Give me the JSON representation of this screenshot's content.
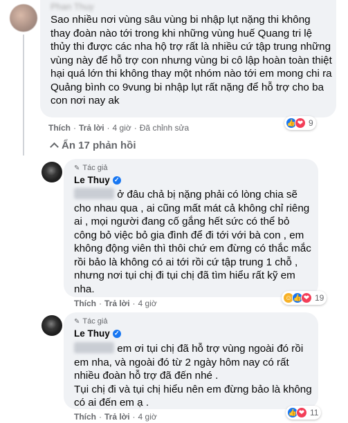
{
  "top_comment": {
    "text": "Sao nhiều nơi vùng sâu vùng bi nhập lụt nặng thi không thay đoàn nào tới trong khi những vùng huế Quang tri lệ thủy thi được các nha hộ trợ rất là nhiều cứ tập trung những vùng này để hỗ trợ con nhưng vùng bi cô lập hoàn toàn thiệt hại quá lớn thi không thay một nhóm nào tới em mong chi ra Quảng bình co 9vung bi nhập lụt rất nặng để hỗ trợ cho ba con nơi nay ak",
    "actions": {
      "like": "Thích",
      "reply": "Trả lời",
      "time": "4 giờ",
      "edited": "Đã chỉnh sửa"
    },
    "reactions": {
      "count": "9",
      "icons": [
        "like-icon",
        "love-icon"
      ]
    }
  },
  "show_replies_label": "Ẩn 17 phản hồi",
  "replies": [
    {
      "author_badge": "Tác giả",
      "author_name": "Le Thuy",
      "text": " ở đâu chả bị nặng phải có lòng chia sẽ cho nhau qua , ai cũng mất mát cả không chỉ riêng ai , mọi người đang cố gắng hết sức có thể bỏ công bỏ việc bỏ gia đình để đi tới với bà con , em không động viên thì thôi chứ em đừng có thắc mắc rồi bảo là không có ai tới rồi cứ tập trung 1 chỗ , nhưng nơi tụi chị đi tụi chị đã tìm hiểu rất kỹ em nha.",
      "actions": {
        "like": "Thích",
        "reply": "Trả lời",
        "time": "4 giờ"
      },
      "reactions": {
        "count": "19",
        "icons": [
          "care-icon",
          "like-icon",
          "love-icon"
        ]
      }
    },
    {
      "author_badge": "Tác giả",
      "author_name": "Le Thuy",
      "text": " em ơi tụi chị đã hỗ trợ vùng ngoài đó rồi em nha, và ngoài đó từ 2 ngày hôm nay có rất nhiều đoàn hỗ trợ đã đến nhé .\nTụi chị đi và tụi chị hiểu nên em đừng bảo là không có ai đến em ạ .",
      "actions": {
        "like": "Thích",
        "reply": "Trả lời",
        "time": "4 giờ"
      },
      "reactions": {
        "count": "11",
        "icons": [
          "like-icon",
          "love-icon"
        ]
      }
    }
  ],
  "colors": {
    "bubble": "#f0f2f5",
    "secondary_text": "#65676b",
    "like": "#1877f2",
    "love": "#f33e58"
  }
}
